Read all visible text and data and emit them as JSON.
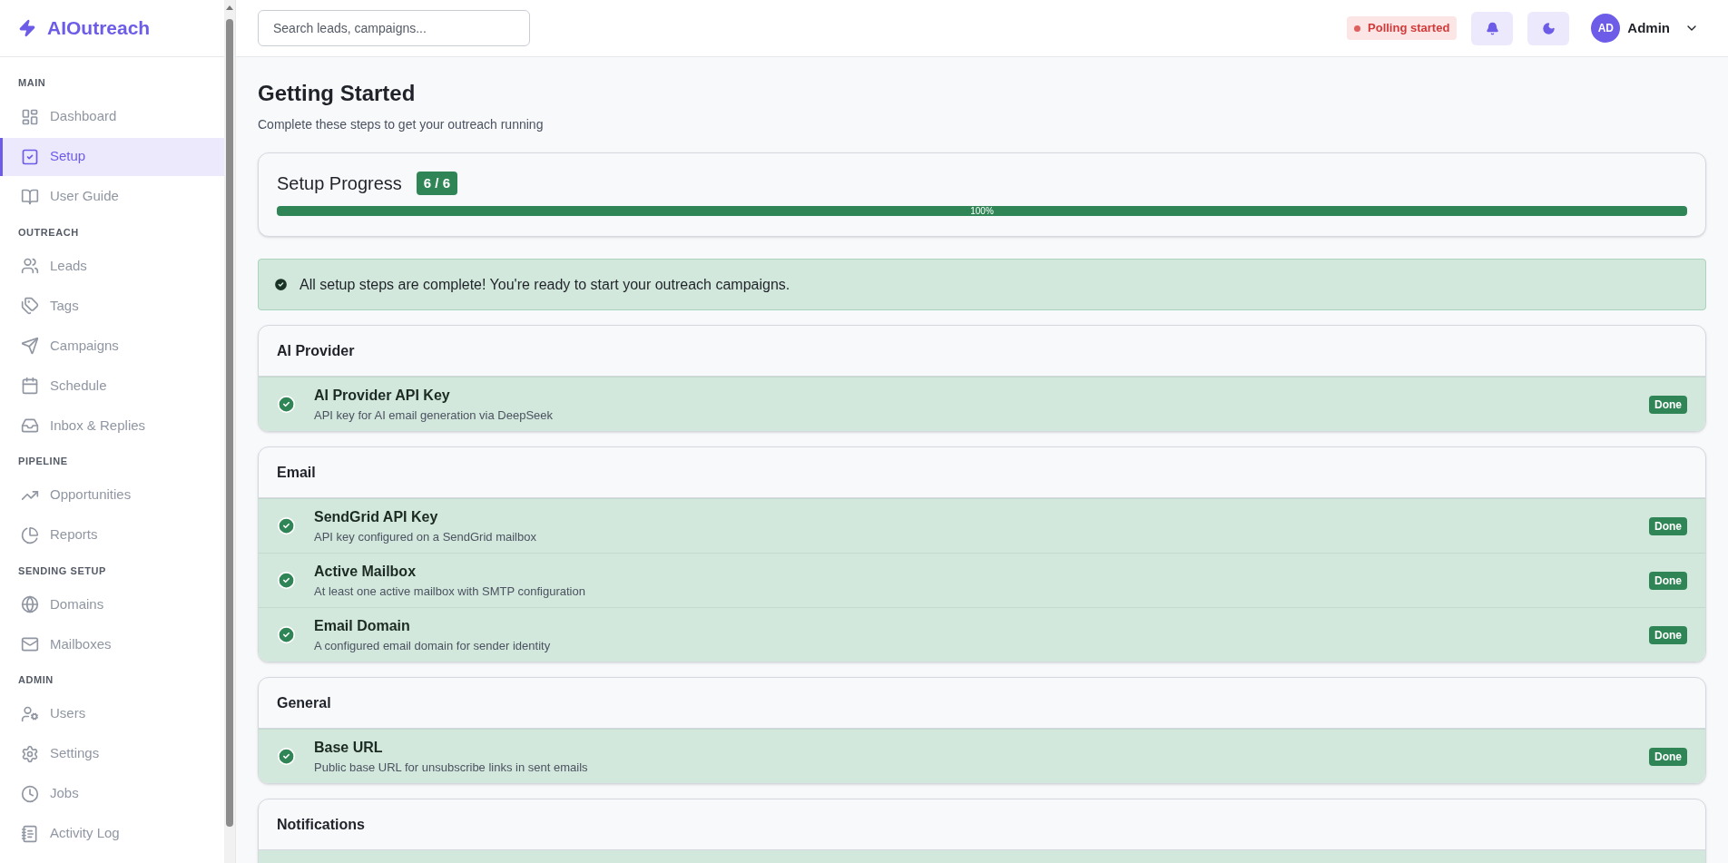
{
  "brand": "AIOutreach",
  "sidebar": {
    "sections": [
      {
        "title": "MAIN",
        "items": [
          {
            "label": "Dashboard",
            "kind": "dashboard",
            "selected": false
          },
          {
            "label": "Setup",
            "kind": "setup",
            "selected": true
          },
          {
            "label": "User Guide",
            "kind": "book",
            "selected": false
          }
        ]
      },
      {
        "title": "OUTREACH",
        "items": [
          {
            "label": "Leads",
            "kind": "users",
            "selected": false
          },
          {
            "label": "Tags",
            "kind": "tags",
            "selected": false
          },
          {
            "label": "Campaigns",
            "kind": "send",
            "selected": false
          },
          {
            "label": "Schedule",
            "kind": "calendar",
            "selected": false
          },
          {
            "label": "Inbox & Replies",
            "kind": "inbox",
            "selected": false
          }
        ]
      },
      {
        "title": "PIPELINE",
        "items": [
          {
            "label": "Opportunities",
            "kind": "chart",
            "selected": false
          },
          {
            "label": "Reports",
            "kind": "pie",
            "selected": false
          }
        ]
      },
      {
        "title": "SENDING SETUP",
        "items": [
          {
            "label": "Domains",
            "kind": "globe",
            "selected": false
          },
          {
            "label": "Mailboxes",
            "kind": "mail",
            "selected": false
          }
        ]
      },
      {
        "title": "ADMIN",
        "items": [
          {
            "label": "Users",
            "kind": "usercog",
            "selected": false
          },
          {
            "label": "Settings",
            "kind": "settings",
            "selected": false
          },
          {
            "label": "Jobs",
            "kind": "clock",
            "selected": false
          },
          {
            "label": "Activity Log",
            "kind": "log",
            "selected": false
          }
        ]
      }
    ]
  },
  "topbar": {
    "search": {
      "placeholder": "Search leads, campaigns..."
    },
    "status": "Polling started",
    "user": {
      "initials": "AD",
      "name": "Admin"
    }
  },
  "page": {
    "title": "Getting Started",
    "subtitle": "Complete these steps to get your outreach running"
  },
  "progress": {
    "title": "Setup Progress",
    "count": "6 / 6",
    "level": 1,
    "percent": "100%"
  },
  "alert": "All setup steps are complete! You're ready to start your outreach campaigns.",
  "groups": [
    {
      "title": "AI Provider",
      "steps": [
        {
          "title": "AI Provider API Key",
          "description": "API key for AI email generation via DeepSeek",
          "done": true,
          "badge": "Done"
        }
      ]
    },
    {
      "title": "Email",
      "steps": [
        {
          "title": "SendGrid API Key",
          "description": "API key configured on a SendGrid mailbox",
          "done": true,
          "badge": "Done"
        },
        {
          "title": "Active Mailbox",
          "description": "At least one active mailbox with SMTP configuration",
          "done": true,
          "badge": "Done"
        },
        {
          "title": "Email Domain",
          "description": "A configured email domain for sender identity",
          "done": true,
          "badge": "Done"
        }
      ]
    },
    {
      "title": "General",
      "steps": [
        {
          "title": "Base URL",
          "description": "Public base URL for unsubscribe links in sent emails",
          "done": true,
          "badge": "Done"
        }
      ]
    },
    {
      "title": "Notifications"
    }
  ]
}
